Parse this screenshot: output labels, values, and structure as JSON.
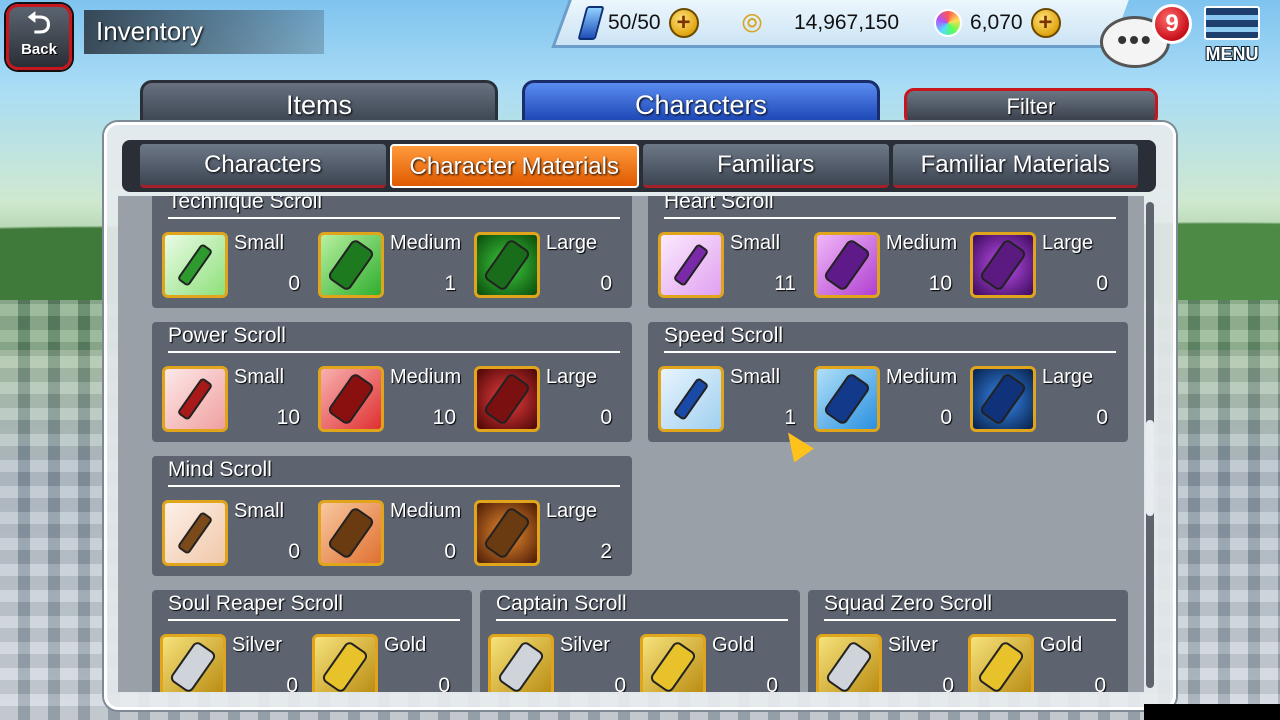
{
  "header": {
    "back_label": "Back",
    "title": "Inventory",
    "stamina": "50/50",
    "coins": "14,967,150",
    "orbs": "6,070",
    "notification_count": "9",
    "menu_label": "MENU"
  },
  "main_tabs": [
    {
      "label": "Items"
    },
    {
      "label": "Characters"
    }
  ],
  "filter_label": "Filter",
  "sub_tabs": [
    {
      "label": "Characters"
    },
    {
      "label": "Character Materials"
    },
    {
      "label": "Familiars"
    },
    {
      "label": "Familiar Materials"
    }
  ],
  "groups": {
    "technique": {
      "title": "Technique Scroll",
      "items": [
        {
          "name": "Small",
          "qty": "0"
        },
        {
          "name": "Medium",
          "qty": "1"
        },
        {
          "name": "Large",
          "qty": "0"
        }
      ]
    },
    "heart": {
      "title": "Heart Scroll",
      "items": [
        {
          "name": "Small",
          "qty": "11"
        },
        {
          "name": "Medium",
          "qty": "10"
        },
        {
          "name": "Large",
          "qty": "0"
        }
      ]
    },
    "power": {
      "title": "Power Scroll",
      "items": [
        {
          "name": "Small",
          "qty": "10"
        },
        {
          "name": "Medium",
          "qty": "10"
        },
        {
          "name": "Large",
          "qty": "0"
        }
      ]
    },
    "speed": {
      "title": "Speed Scroll",
      "items": [
        {
          "name": "Small",
          "qty": "1"
        },
        {
          "name": "Medium",
          "qty": "0"
        },
        {
          "name": "Large",
          "qty": "0"
        }
      ]
    },
    "mind": {
      "title": "Mind Scroll",
      "items": [
        {
          "name": "Small",
          "qty": "0"
        },
        {
          "name": "Medium",
          "qty": "0"
        },
        {
          "name": "Large",
          "qty": "2"
        }
      ]
    },
    "soul_reaper": {
      "title": "Soul Reaper Scroll",
      "items": [
        {
          "name": "Silver",
          "qty": "0"
        },
        {
          "name": "Gold",
          "qty": "0"
        }
      ]
    },
    "captain": {
      "title": "Captain Scroll",
      "items": [
        {
          "name": "Silver",
          "qty": "0"
        },
        {
          "name": "Gold",
          "qty": "0"
        }
      ]
    },
    "squad_zero": {
      "title": "Squad Zero Scroll",
      "items": [
        {
          "name": "Silver",
          "qty": "0"
        },
        {
          "name": "Gold",
          "qty": "0"
        }
      ]
    }
  },
  "colors": {
    "active_subtab": "#e05a00",
    "green": "#2e9a2e",
    "purple": "#7a2aa8",
    "red": "#a81a1a",
    "blue": "#1a4aa8",
    "brown": "#7a4a1a",
    "silver": "#cfd4da",
    "gold": "#e8c22a"
  }
}
